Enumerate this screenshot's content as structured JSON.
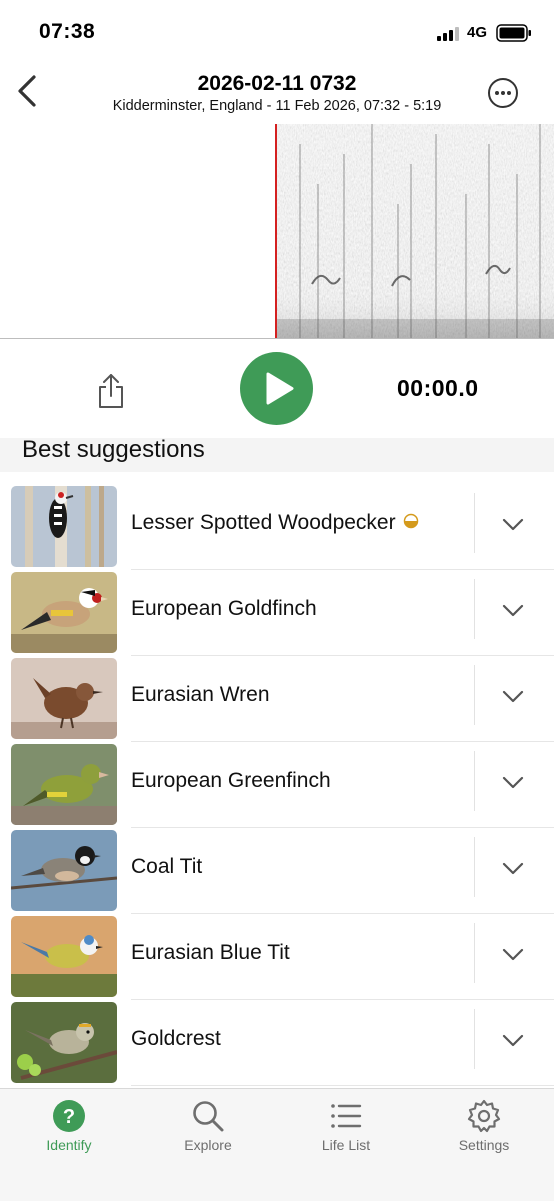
{
  "status_bar": {
    "time": "07:38",
    "network": "4G"
  },
  "header": {
    "title": "2026-02-11 0732",
    "subtitle": "Kidderminster, England - 11 Feb 2026, 07:32 - 5:19"
  },
  "player": {
    "time": "00:00.0",
    "accent_color": "#3f9b57"
  },
  "section": {
    "title": "Best suggestions"
  },
  "suggestions": [
    {
      "name": "Lesser Spotted Woodpecker",
      "confidence_badge": "half"
    },
    {
      "name": "European Goldfinch"
    },
    {
      "name": "Eurasian Wren"
    },
    {
      "name": "European Greenfinch"
    },
    {
      "name": "Coal Tit"
    },
    {
      "name": "Eurasian Blue Tit"
    },
    {
      "name": "Goldcrest"
    }
  ],
  "tabs": [
    {
      "label": "Identify",
      "icon": "question-icon",
      "active": true
    },
    {
      "label": "Explore",
      "icon": "search-icon"
    },
    {
      "label": "Life List",
      "icon": "list-icon"
    },
    {
      "label": "Settings",
      "icon": "gear-icon"
    }
  ]
}
